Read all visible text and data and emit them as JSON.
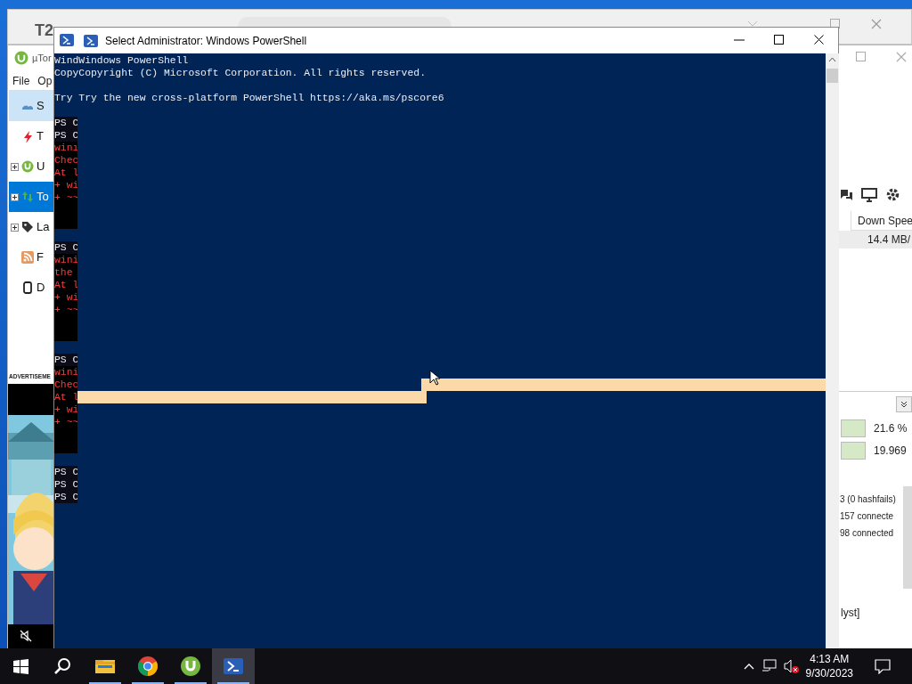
{
  "back_window": {
    "app_icon": "T2"
  },
  "utorrent": {
    "title": "µTor",
    "menu": [
      "File",
      "Op"
    ],
    "sidebar": [
      {
        "label": "S",
        "expandable": false,
        "hovered": true,
        "selected": false
      },
      {
        "label": "T",
        "expandable": false,
        "hovered": false,
        "selected": false
      },
      {
        "label": "U",
        "expandable": true,
        "hovered": false,
        "selected": false
      },
      {
        "label": "To",
        "expandable": true,
        "hovered": false,
        "selected": true
      },
      {
        "label": "La",
        "expandable": true,
        "hovered": false,
        "selected": false
      },
      {
        "label": "F",
        "expandable": false,
        "hovered": false,
        "selected": false
      },
      {
        "label": "D",
        "expandable": false,
        "hovered": false,
        "selected": false
      }
    ],
    "ad_label": "ADVERTISEME",
    "ad": {
      "kind": "picture"
    },
    "column_header": "Down Spee",
    "row_value": "14.4 MB/",
    "meters": [
      {
        "reading": "21.6 %"
      },
      {
        "reading": "19.969"
      }
    ],
    "info_lines": [
      "3 (0 hashfails)",
      "157 connecte",
      "98 connected"
    ],
    "footer_text": "lyst]"
  },
  "powershell": {
    "title": "Select Administrator: Windows PowerShell",
    "rows": [
      {
        "kind": "output",
        "text": "WindWindows PowerShell"
      },
      {
        "kind": "output",
        "text": "CopyCopyright (C) Microsoft Corporation. All rights reserved."
      },
      {
        "kind": "blank"
      },
      {
        "kind": "output",
        "text": "Try Try the new cross-platform PowerShell https://aka.ms/pscore6"
      },
      {
        "kind": "blank"
      },
      {
        "kind": "prompt",
        "text": "PS C"
      },
      {
        "kind": "prompt",
        "text": "PS C"
      },
      {
        "kind": "error",
        "text": "winı"
      },
      {
        "kind": "error",
        "text": "Chec"
      },
      {
        "kind": "error",
        "text": "At l"
      },
      {
        "kind": "error",
        "text": "+ wi"
      },
      {
        "kind": "error",
        "text": "+ ~~"
      },
      {
        "kind": "black_gap"
      },
      {
        "kind": "black_gap"
      },
      {
        "kind": "blank"
      },
      {
        "kind": "prompt",
        "text": "PS C"
      },
      {
        "kind": "error",
        "text": "wini"
      },
      {
        "kind": "error",
        "text": "the"
      },
      {
        "kind": "error",
        "text": "At l"
      },
      {
        "kind": "error",
        "text": "+ wi"
      },
      {
        "kind": "error",
        "text": "+ ~~"
      },
      {
        "kind": "black_gap"
      },
      {
        "kind": "black_gap"
      },
      {
        "kind": "blank"
      },
      {
        "kind": "prompt",
        "text": "PS C"
      },
      {
        "kind": "error",
        "text": "wini"
      },
      {
        "kind": "error",
        "text": "Chec"
      },
      {
        "kind": "error",
        "text": "At l"
      },
      {
        "kind": "error",
        "text": "+ wi"
      },
      {
        "kind": "error",
        "text": "+ ~~"
      },
      {
        "kind": "black_gap"
      },
      {
        "kind": "black_gap"
      },
      {
        "kind": "blank"
      },
      {
        "kind": "prompt",
        "text": "PS C"
      },
      {
        "kind": "prompt",
        "text": "PS C"
      },
      {
        "kind": "prompt",
        "text": "PS C"
      }
    ]
  },
  "taskbar": {
    "apps": [
      {
        "kind": "explorer",
        "open": true,
        "active": false
      },
      {
        "kind": "chrome",
        "open": true,
        "active": false
      },
      {
        "kind": "utorrent",
        "open": true,
        "active": false
      },
      {
        "kind": "powershell",
        "open": true,
        "active": true
      }
    ],
    "time": "4:13 AM",
    "date": "9/30/2023"
  }
}
